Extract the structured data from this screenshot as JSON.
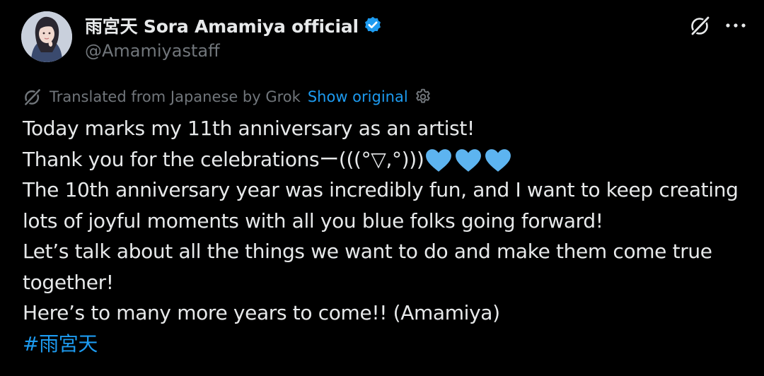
{
  "author": {
    "display_name": "雨宮天 Sora Amamiya official",
    "handle": "@Amamiyastaff",
    "verified": true
  },
  "translation": {
    "note": "Translated from Japanese by Grok",
    "show_original_label": "Show original"
  },
  "tweet": {
    "lines": [
      "Today marks my 11th anniversary as an artist!",
      "Thank you for the celebrationsー(((°▽,°)))",
      "The 10th anniversary year was incredibly fun, and I want to keep creating",
      "lots of joyful moments with all you blue folks going forward!",
      "Let’s talk about all the things we want to do and make them come true",
      "together!",
      "Here’s to many more years to come!! (Amamiya)"
    ],
    "hashtag": "#雨宮天",
    "emoji": "blue-heart-emoji"
  },
  "icons": {
    "verified": "verified-badge-icon",
    "grok": "grok-icon",
    "more": "more-options-icon",
    "settings": "settings-gear-icon"
  },
  "colors": {
    "background": "#000000",
    "text": "#e7e9ea",
    "secondary_text": "#71767b",
    "accent": "#1d9bf0",
    "heart": "#5db4f0"
  }
}
